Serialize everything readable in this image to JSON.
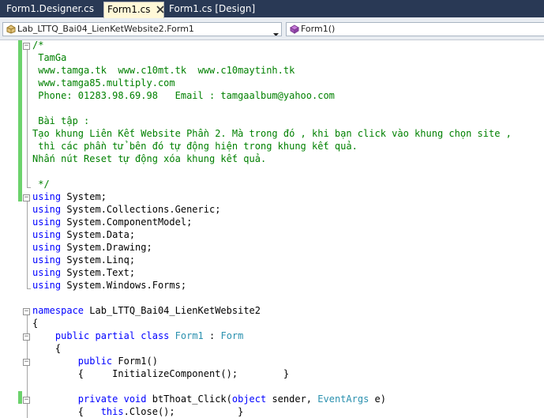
{
  "tabs": [
    {
      "label": "Form1.Designer.cs",
      "active": false
    },
    {
      "label": "Form1.cs",
      "active": true,
      "close_icon": "close-icon"
    },
    {
      "label": "Form1.cs [Design]",
      "active": false
    }
  ],
  "navbar": {
    "class_combo": {
      "value": "Lab_LTTQ_Bai04_LienKetWebsite2.Form1",
      "icon": "class-icon"
    },
    "member_combo": {
      "value": "Form1()",
      "icon": "method-icon"
    }
  },
  "code": {
    "comment": [
      "/*",
      " TamGa",
      " www.tamga.tk  www.c10mt.tk  www.c10maytinh.tk",
      " www.tamga85.multiply.com",
      " Phone: 01283.98.69.98   Email : tamgaalbum@yahoo.com",
      "",
      " Bài tập :",
      "Tạo khung Liên Kết Website Phần 2. Mà trong đó , khi bạn click vào khung chọn site ,",
      " thì các phần tử bên đó tự động hiện trong khung kết quả.",
      "Nhấn nút Reset tự động xóa khung kết quả.",
      "",
      " */"
    ],
    "using_keyword": "using",
    "usings": [
      "System;",
      "System.Collections.Generic;",
      "System.ComponentModel;",
      "System.Data;",
      "System.Drawing;",
      "System.Linq;",
      "System.Text;",
      "System.Windows.Forms;"
    ],
    "namespace_line": {
      "keyword": "namespace",
      "name": " Lab_LTTQ_Bai04_LienKetWebsite2"
    },
    "brace_open": "{",
    "class_line": {
      "indent": "    ",
      "kw1": "public",
      "kw2": " partial",
      "kw3": " class",
      "name": " Form1",
      "colon": " : ",
      "base": "Form"
    },
    "class_brace": "    {",
    "ctor_line": {
      "indent": "        ",
      "kw": "public",
      "rest": " Form1()"
    },
    "ctor_body": "        {     InitializeComponent();        }",
    "method_line": {
      "indent": "        ",
      "kw1": "private",
      "kw2": " void",
      "name": " btThoat_Click(",
      "kw3": "object",
      "p1": " sender, ",
      "type": "EventArgs",
      "p2": " e)"
    },
    "method_body": {
      "pre": "        {   ",
      "kw": "this",
      "post": ".Close();           }"
    }
  }
}
